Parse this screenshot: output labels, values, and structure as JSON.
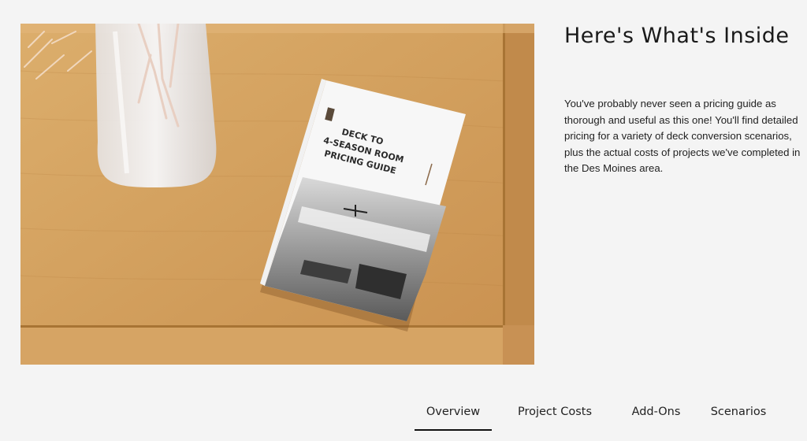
{
  "section": {
    "heading": "Here's What's Inside",
    "description": "You've probably never seen a pricing guide as thorough and useful as this one! You'll find detailed pricing for a variety of deck conversion scenarios, plus the actual costs of projects we've completed in the Des Moines area."
  },
  "book": {
    "title_line1": "DECK TO",
    "title_line2": "4-SEASON ROOM",
    "title_line3": "PRICING GUIDE"
  },
  "tabs": [
    {
      "label": "Overview",
      "active": true
    },
    {
      "label": "Project Costs",
      "active": false
    },
    {
      "label": "Add-Ons",
      "active": false
    },
    {
      "label": "Scenarios",
      "active": false
    }
  ]
}
